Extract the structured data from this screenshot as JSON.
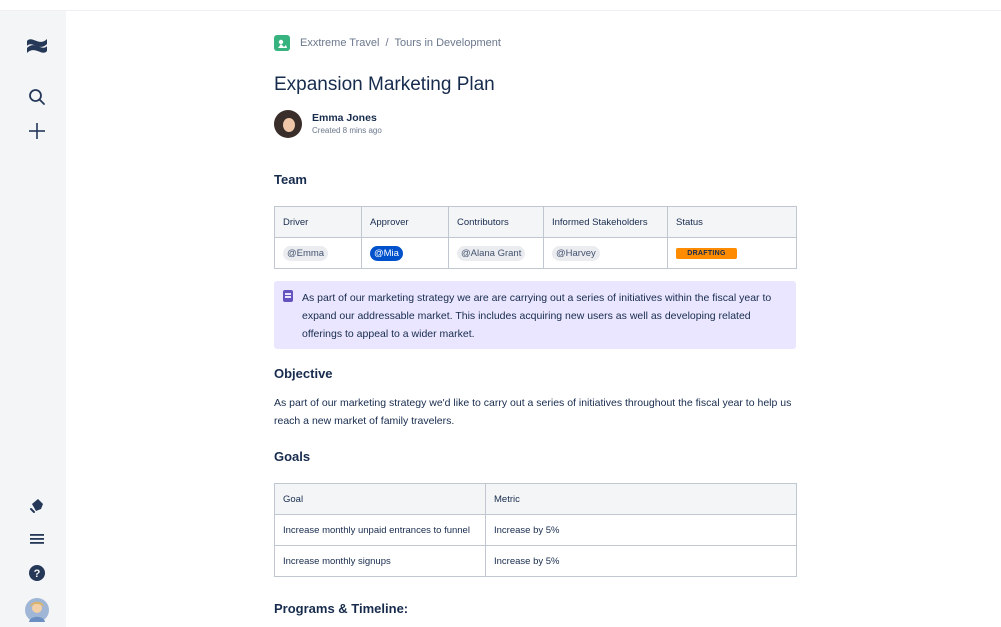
{
  "sidebar": {
    "icons": [
      "confluence-logo",
      "search-icon",
      "create-icon",
      "notifications-icon",
      "menu-icon",
      "help-icon",
      "profile-avatar"
    ]
  },
  "breadcrumb": {
    "space": "Exxtreme Travel",
    "separator": "/",
    "page": "Tours in Development"
  },
  "page": {
    "title": "Expansion Marketing Plan",
    "author": "Emma Jones",
    "created": "Created 8 mins ago"
  },
  "team": {
    "heading": "Team",
    "headers": [
      "Driver",
      "Approver",
      "Contributors",
      "Informed Stakeholders",
      "Status"
    ],
    "row": {
      "driver": "@Emma",
      "approver": "@Mia",
      "contributors": "@Alana Grant",
      "stakeholders": "@Harvey",
      "status": "DRAFTING"
    }
  },
  "note": {
    "text": "As part of our marketing strategy we are are carrying out a series of initiatives within the fiscal year to expand our addressable market. This includes acquiring new users as well as developing related offerings to appeal to a wider market."
  },
  "objective": {
    "heading": "Objective",
    "text": "As part of our marketing strategy we'd like to carry out a series of initiatives throughout the fiscal year to help us reach a new market of family travelers."
  },
  "goals": {
    "heading": "Goals",
    "headers": [
      "Goal",
      "Metric"
    ],
    "rows": [
      {
        "goal": "Increase monthly unpaid entrances to funnel",
        "metric": "Increase by 5%"
      },
      {
        "goal": "Increase monthly signups",
        "metric": "Increase by 5%"
      }
    ]
  },
  "programs": {
    "heading": "Programs & Timeline:"
  },
  "colors": {
    "brand": "#0052CC",
    "panel": "#EAE6FF",
    "lozenge": "#FF8B00",
    "sidebar": "#F4F5F7"
  }
}
